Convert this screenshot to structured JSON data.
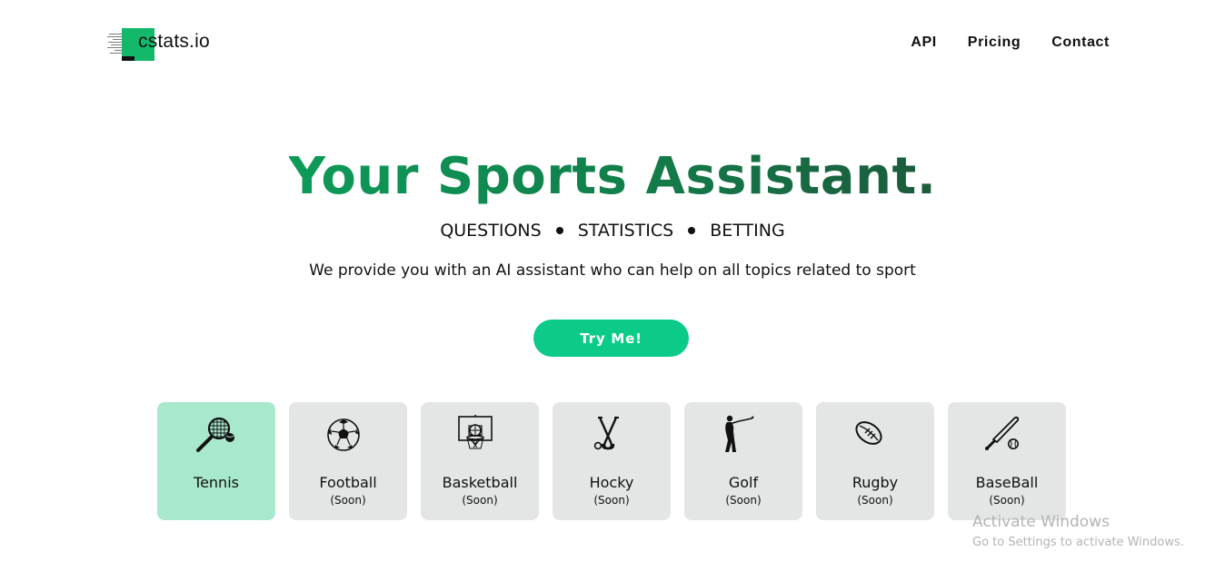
{
  "header": {
    "logo_text": "cstats.io",
    "nav": [
      "API",
      "Pricing",
      "Contact"
    ]
  },
  "hero": {
    "title": "Your Sports Assistant.",
    "tags": [
      "QUESTIONS",
      "STATISTICS",
      "BETTING"
    ],
    "description": "We provide you with an AI assistant who can help on all topics related to sport",
    "cta_label": "Try Me!"
  },
  "sports": [
    {
      "name": "Tennis",
      "status": "",
      "icon": "tennis-racket-icon",
      "active": true
    },
    {
      "name": "Football",
      "status": "(Soon)",
      "icon": "soccer-ball-icon",
      "active": false
    },
    {
      "name": "Basketball",
      "status": "(Soon)",
      "icon": "basketball-hoop-icon",
      "active": false
    },
    {
      "name": "Hocky",
      "status": "(Soon)",
      "icon": "hockey-sticks-icon",
      "active": false
    },
    {
      "name": "Golf",
      "status": "(Soon)",
      "icon": "golfer-icon",
      "active": false
    },
    {
      "name": "Rugby",
      "status": "(Soon)",
      "icon": "rugby-ball-icon",
      "active": false
    },
    {
      "name": "BaseBall",
      "status": "(Soon)",
      "icon": "baseball-bat-icon",
      "active": false
    }
  ],
  "watermark": {
    "title": "Activate Windows",
    "subtitle": "Go to Settings to activate Windows."
  },
  "colors": {
    "brand_green": "#14b86a",
    "cta": "#0ccb88",
    "active_card": "#a8e8cc",
    "card": "#e3e6e5"
  }
}
